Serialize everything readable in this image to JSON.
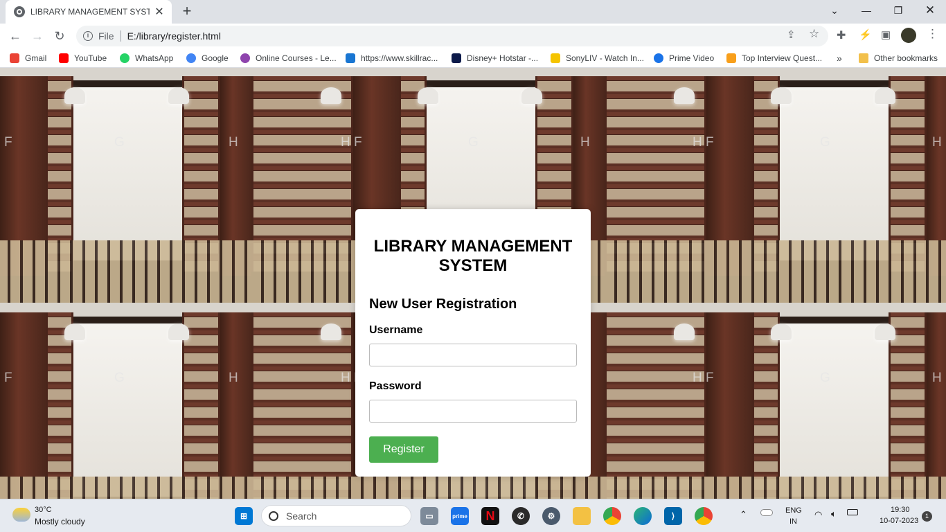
{
  "browser": {
    "tab_title": "LIBRARY MANAGEMENT SYSTEM",
    "new_tab": "+",
    "url_scheme": "File",
    "url": "E:/library/register.html"
  },
  "bookmarks": [
    {
      "label": "Gmail",
      "color": "#ea4335"
    },
    {
      "label": "YouTube",
      "color": "#ff0000"
    },
    {
      "label": "WhatsApp",
      "color": "#25d366"
    },
    {
      "label": "Google",
      "color": "#4285f4"
    },
    {
      "label": "Online Courses - Le...",
      "color": "#8e44ad"
    },
    {
      "label": "https://www.skillrac...",
      "color": "#1976d2"
    },
    {
      "label": "Disney+ Hotstar -...",
      "color": "#0c1a4a"
    },
    {
      "label": "SonyLIV - Watch In...",
      "color": "#f5c400"
    },
    {
      "label": "Prime Video",
      "color": "#1a73e8"
    },
    {
      "label": "Top Interview Quest...",
      "color": "#f89f1b"
    }
  ],
  "other_bookmarks": "Other bookmarks",
  "more_bookmarks": "»",
  "background": {
    "letters": [
      "F",
      "G",
      "H",
      "H F",
      "G",
      "H",
      "H F",
      "G",
      "H"
    ]
  },
  "form": {
    "heading": "LIBRARY MANAGEMENT SYSTEM",
    "subheading": "New User Registration",
    "username_label": "Username",
    "username_value": "",
    "password_label": "Password",
    "password_value": "",
    "submit_label": "Register",
    "submit_color": "#4caf50"
  },
  "taskbar": {
    "weather_temp": "30°C",
    "weather_desc": "Mostly cloudy",
    "search_placeholder": "Search",
    "lang": "ENG",
    "region": "IN",
    "time": "19:30",
    "date": "10-07-2023",
    "notification_count": "1"
  }
}
